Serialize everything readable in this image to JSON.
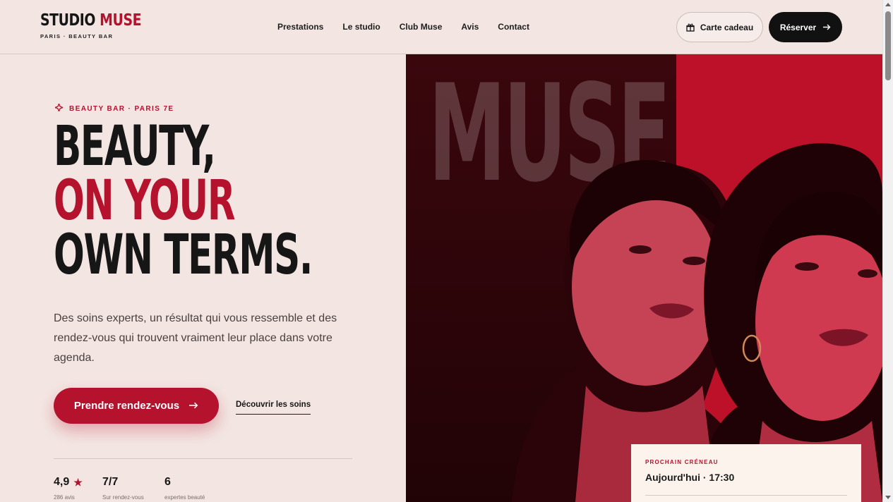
{
  "header": {
    "logo_main": "STUDIO",
    "logo_accent": "MUSE",
    "logo_sub": "PARIS · BEAUTY BAR",
    "nav": [
      "Prestations",
      "Le studio",
      "Club Muse",
      "Avis",
      "Contact"
    ],
    "gift_label": "Carte cadeau",
    "book_label": "Réserver"
  },
  "hero": {
    "eyebrow": "BEAUTY BAR · PARIS 7E",
    "headline": [
      "BEAUTY,",
      "ON YOUR",
      "OWN TERMS."
    ],
    "intro": "Des soins experts, un résultat qui vous ressemble et des rendez-vous qui trouvent vraiment leur place dans votre agenda.",
    "cta_label": "Prendre rendez-vous",
    "secondary_label": "Découvrir les soins",
    "stats": [
      {
        "value": "4,9",
        "label": "286 avis"
      },
      {
        "value": "7/7",
        "label": "Sur rendez-vous"
      },
      {
        "value": "6",
        "label": "expertes beauté"
      }
    ]
  },
  "visual": {
    "word": "MUSE",
    "slot_label": "PROCHAIN CRÉNEAU",
    "slot_value": "Aujourd'hui · 17:30"
  },
  "colors": {
    "accent": "#b5122d",
    "background": "#f3e6e2",
    "dark": "#111111"
  },
  "icons": {
    "eyebrow": "sparkle-icon",
    "gift": "gift-icon",
    "arrow": "arrow-right-icon",
    "rating": "star-icon"
  }
}
